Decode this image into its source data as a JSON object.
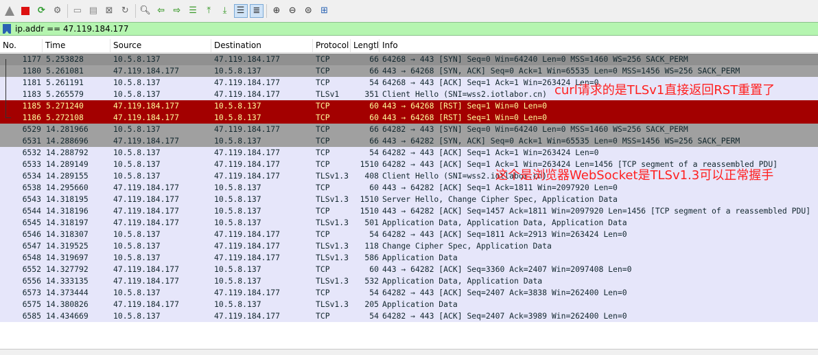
{
  "toolbar": {
    "icons": [
      "shark-fin-icon",
      "stop-capture-icon",
      "restart-capture-icon",
      "capture-options-icon",
      "open-file-icon",
      "save-file-icon",
      "close-file-icon",
      "reload-icon",
      "find-packet-icon",
      "go-back-icon",
      "go-forward-icon",
      "go-to-packet-icon",
      "go-first-icon",
      "go-last-icon",
      "autoscroll-icon",
      "colorize-icon",
      "zoom-in-icon",
      "zoom-out-icon",
      "normal-size-icon",
      "resize-columns-icon"
    ]
  },
  "filter": {
    "value": "ip.addr == 47.119.184.177"
  },
  "columns": [
    "No.",
    "Time",
    "Source",
    "Destination",
    "Protocol",
    "Lengtl",
    "Info"
  ],
  "packets": [
    {
      "no": "1177",
      "time": "5.253828",
      "src": "10.5.8.137",
      "dst": "47.119.184.177",
      "proto": "TCP",
      "len": "66",
      "info": "64268 → 443 [SYN] Seq=0 Win=64240 Len=0 MSS=1460 WS=256 SACK_PERM",
      "style": "syn dark"
    },
    {
      "no": "1180",
      "time": "5.261081",
      "src": "47.119.184.177",
      "dst": "10.5.8.137",
      "proto": "TCP",
      "len": "66",
      "info": "443 → 64268 [SYN, ACK] Seq=0 Ack=1 Win=65535 Len=0 MSS=1456 WS=256 SACK_PERM",
      "style": "syn"
    },
    {
      "no": "1181",
      "time": "5.261191",
      "src": "10.5.8.137",
      "dst": "47.119.184.177",
      "proto": "TCP",
      "len": "54",
      "info": "64268 → 443 [ACK] Seq=1 Ack=1 Win=263424 Len=0",
      "style": ""
    },
    {
      "no": "1183",
      "time": "5.265579",
      "src": "10.5.8.137",
      "dst": "47.119.184.177",
      "proto": "TLSv1",
      "len": "351",
      "info": "Client Hello (SNI=wss2.iotlabor.cn)",
      "style": ""
    },
    {
      "no": "1185",
      "time": "5.271240",
      "src": "47.119.184.177",
      "dst": "10.5.8.137",
      "proto": "TCP",
      "len": "60",
      "info": "443 → 64268 [RST] Seq=1 Win=0 Len=0",
      "style": "rst"
    },
    {
      "no": "1186",
      "time": "5.272108",
      "src": "47.119.184.177",
      "dst": "10.5.8.137",
      "proto": "TCP",
      "len": "60",
      "info": "443 → 64268 [RST] Seq=1 Win=0 Len=0",
      "style": "rst"
    },
    {
      "no": "6529",
      "time": "14.281966",
      "src": "10.5.8.137",
      "dst": "47.119.184.177",
      "proto": "TCP",
      "len": "66",
      "info": "64282 → 443 [SYN] Seq=0 Win=64240 Len=0 MSS=1460 WS=256 SACK_PERM",
      "style": "syn"
    },
    {
      "no": "6531",
      "time": "14.288696",
      "src": "47.119.184.177",
      "dst": "10.5.8.137",
      "proto": "TCP",
      "len": "66",
      "info": "443 → 64282 [SYN, ACK] Seq=0 Ack=1 Win=65535 Len=0 MSS=1456 WS=256 SACK_PERM",
      "style": "syn"
    },
    {
      "no": "6532",
      "time": "14.288792",
      "src": "10.5.8.137",
      "dst": "47.119.184.177",
      "proto": "TCP",
      "len": "54",
      "info": "64282 → 443 [ACK] Seq=1 Ack=1 Win=263424 Len=0",
      "style": ""
    },
    {
      "no": "6533",
      "time": "14.289149",
      "src": "10.5.8.137",
      "dst": "47.119.184.177",
      "proto": "TCP",
      "len": "1510",
      "info": "64282 → 443 [ACK] Seq=1 Ack=1 Win=263424 Len=1456 [TCP segment of a reassembled PDU]",
      "style": ""
    },
    {
      "no": "6534",
      "time": "14.289155",
      "src": "10.5.8.137",
      "dst": "47.119.184.177",
      "proto": "TLSv1.3",
      "len": "408",
      "info": "Client Hello (SNI=wss2.iotlabor.cn)",
      "style": ""
    },
    {
      "no": "6538",
      "time": "14.295660",
      "src": "47.119.184.177",
      "dst": "10.5.8.137",
      "proto": "TCP",
      "len": "60",
      "info": "443 → 64282 [ACK] Seq=1 Ack=1811 Win=2097920 Len=0",
      "style": ""
    },
    {
      "no": "6543",
      "time": "14.318195",
      "src": "47.119.184.177",
      "dst": "10.5.8.137",
      "proto": "TLSv1.3",
      "len": "1510",
      "info": "Server Hello, Change Cipher Spec, Application Data",
      "style": ""
    },
    {
      "no": "6544",
      "time": "14.318196",
      "src": "47.119.184.177",
      "dst": "10.5.8.137",
      "proto": "TCP",
      "len": "1510",
      "info": "443 → 64282 [ACK] Seq=1457 Ack=1811 Win=2097920 Len=1456 [TCP segment of a reassembled PDU]",
      "style": ""
    },
    {
      "no": "6545",
      "time": "14.318197",
      "src": "47.119.184.177",
      "dst": "10.5.8.137",
      "proto": "TLSv1.3",
      "len": "501",
      "info": "Application Data, Application Data, Application Data",
      "style": ""
    },
    {
      "no": "6546",
      "time": "14.318307",
      "src": "10.5.8.137",
      "dst": "47.119.184.177",
      "proto": "TCP",
      "len": "54",
      "info": "64282 → 443 [ACK] Seq=1811 Ack=2913 Win=263424 Len=0",
      "style": ""
    },
    {
      "no": "6547",
      "time": "14.319525",
      "src": "10.5.8.137",
      "dst": "47.119.184.177",
      "proto": "TLSv1.3",
      "len": "118",
      "info": "Change Cipher Spec, Application Data",
      "style": ""
    },
    {
      "no": "6548",
      "time": "14.319697",
      "src": "10.5.8.137",
      "dst": "47.119.184.177",
      "proto": "TLSv1.3",
      "len": "586",
      "info": "Application Data",
      "style": ""
    },
    {
      "no": "6552",
      "time": "14.327792",
      "src": "47.119.184.177",
      "dst": "10.5.8.137",
      "proto": "TCP",
      "len": "60",
      "info": "443 → 64282 [ACK] Seq=3360 Ack=2407 Win=2097408 Len=0",
      "style": ""
    },
    {
      "no": "6556",
      "time": "14.333135",
      "src": "47.119.184.177",
      "dst": "10.5.8.137",
      "proto": "TLSv1.3",
      "len": "532",
      "info": "Application Data, Application Data",
      "style": ""
    },
    {
      "no": "6573",
      "time": "14.373444",
      "src": "10.5.8.137",
      "dst": "47.119.184.177",
      "proto": "TCP",
      "len": "54",
      "info": "64282 → 443 [ACK] Seq=2407 Ack=3838 Win=262400 Len=0",
      "style": ""
    },
    {
      "no": "6575",
      "time": "14.380826",
      "src": "47.119.184.177",
      "dst": "10.5.8.137",
      "proto": "TLSv1.3",
      "len": "205",
      "info": "Application Data",
      "style": ""
    },
    {
      "no": "6585",
      "time": "14.434669",
      "src": "10.5.8.137",
      "dst": "47.119.184.177",
      "proto": "TCP",
      "len": "54",
      "info": "64282 → 443 [ACK] Seq=2407 Ack=3989 Win=262400 Len=0",
      "style": ""
    }
  ],
  "annotations": {
    "curl_note": "curl请求的是TLSv1直接返回RST重置了",
    "browser_note": "这个是浏览器WebSocket是TLSv1.3可以正常握手"
  },
  "colors": {
    "filter_bg": "#b5f5b0",
    "row_default": "#e6e6fa",
    "row_syn": "#a0a0a0",
    "row_rst": "#a30000",
    "rst_text": "#fffc9c",
    "annotation": "#ff2020"
  }
}
